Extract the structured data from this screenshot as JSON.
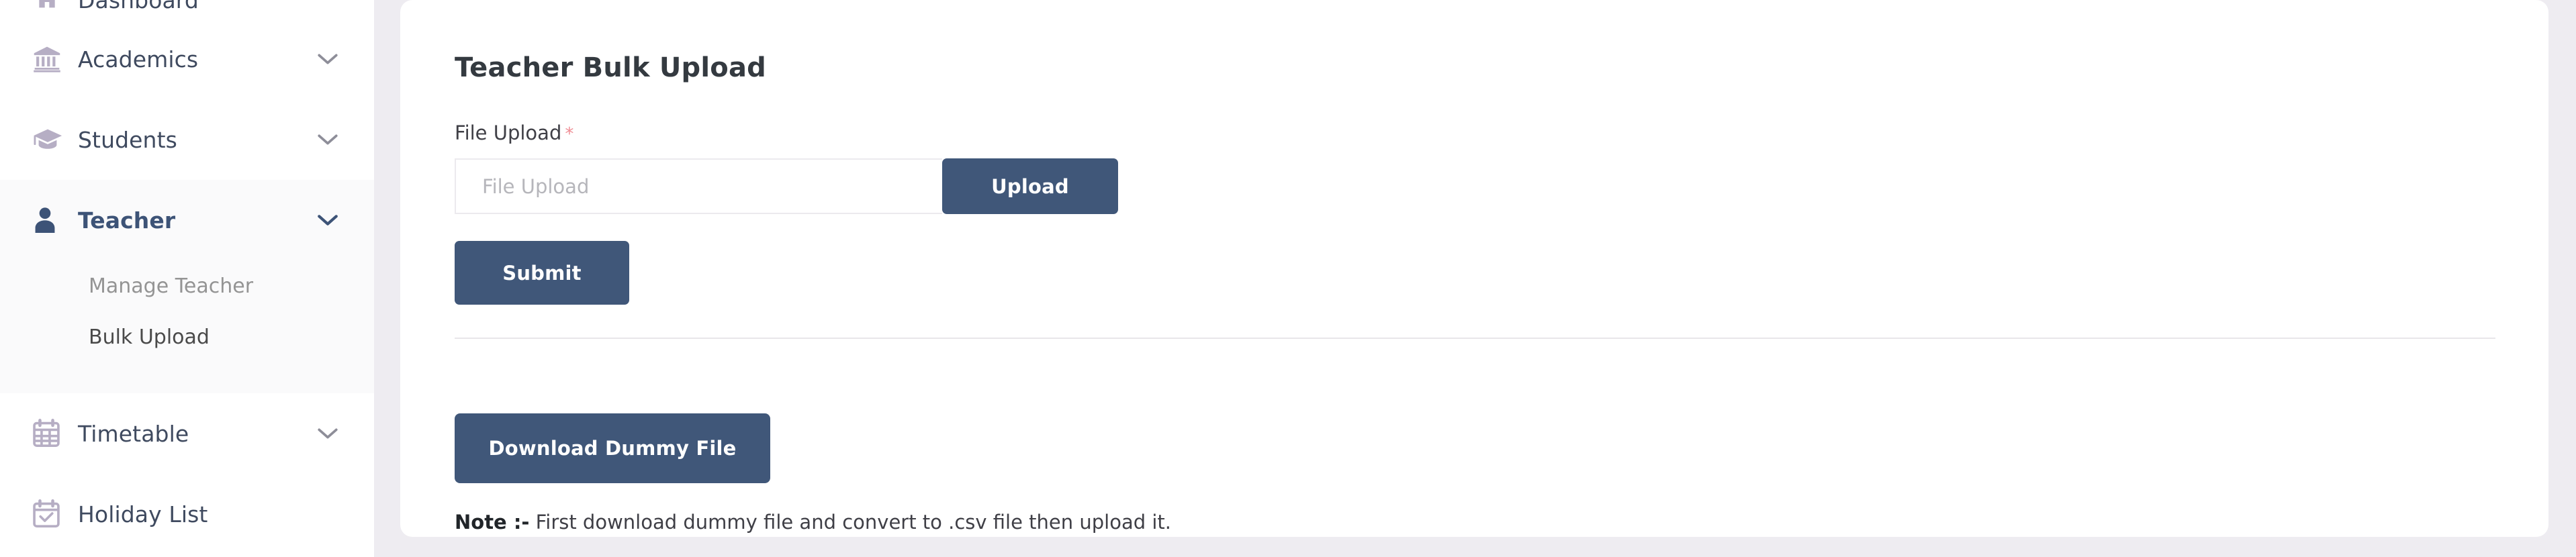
{
  "sidebar": {
    "items": [
      {
        "label": "Dashboard",
        "icon": "home-icon",
        "has_chevron": false,
        "active": false,
        "key": "dashboard"
      },
      {
        "label": "Academics",
        "icon": "bank-icon",
        "has_chevron": true,
        "active": false,
        "key": "academics"
      },
      {
        "label": "Students",
        "icon": "graduation-cap-icon",
        "has_chevron": true,
        "active": false,
        "key": "students"
      },
      {
        "label": "Teacher",
        "icon": "user-icon",
        "has_chevron": true,
        "active": true,
        "key": "teacher"
      },
      {
        "label": "Timetable",
        "icon": "calendar-grid-icon",
        "has_chevron": true,
        "active": false,
        "key": "timetable"
      },
      {
        "label": "Holiday List",
        "icon": "calendar-check-icon",
        "has_chevron": false,
        "active": false,
        "key": "holiday-list"
      }
    ],
    "teacher_submenu": [
      {
        "label": "Manage Teacher",
        "active": false
      },
      {
        "label": "Bulk Upload",
        "active": true
      }
    ]
  },
  "main": {
    "page_title": "Teacher Bulk Upload",
    "file_upload": {
      "label": "File Upload",
      "required_marker": "*",
      "input_value": "",
      "input_placeholder": "File Upload",
      "upload_button": "Upload"
    },
    "submit_button": "Submit",
    "download_button": "Download Dummy File",
    "note": {
      "prefix": "Note :-",
      "text": " First download dummy file and convert to .csv file then upload it."
    }
  },
  "colors": {
    "accent": "#405779",
    "page_background": "#eeecf1",
    "card_background": "#ffffff",
    "sidebar_background": "#ffffff",
    "active_group_background": "#fafafb",
    "required_star": "#ef8d94",
    "icon_inactive": "#b6aec4",
    "icon_active": "#3d5377",
    "text_primary": "#3f4a5f",
    "text_muted": "#949494",
    "divider": "#e8e6ea"
  }
}
